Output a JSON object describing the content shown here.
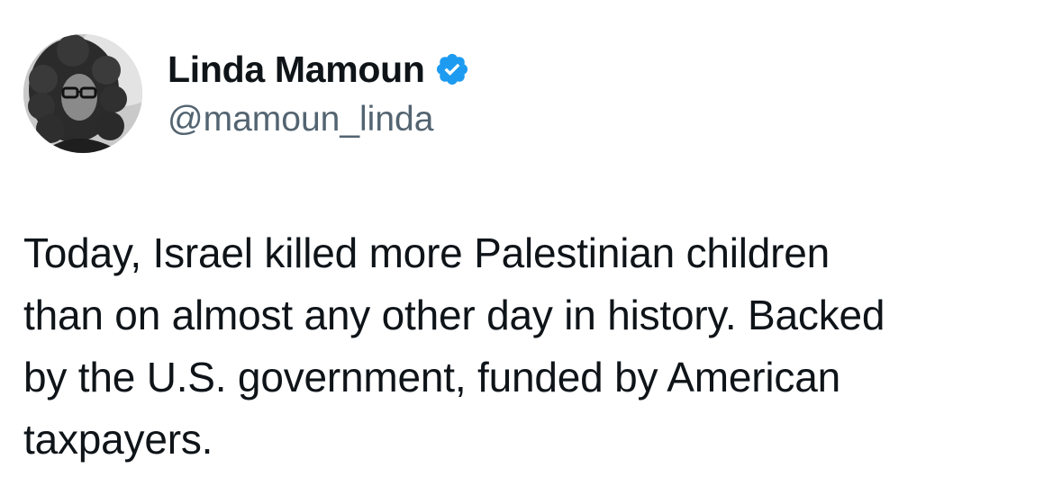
{
  "author": {
    "display_name": "Linda Mamoun",
    "handle": "@mamoun_linda",
    "verified": true,
    "verified_color": "#1d9bf0"
  },
  "tweet": {
    "lines": [
      "Today, Israel killed more Palestinian children",
      "than on almost any other day in history. Backed",
      "by the U.S. government, funded by American",
      "taxpayers."
    ]
  },
  "colors": {
    "text_primary": "#0f1419",
    "text_secondary": "#536471",
    "background": "#ffffff"
  }
}
